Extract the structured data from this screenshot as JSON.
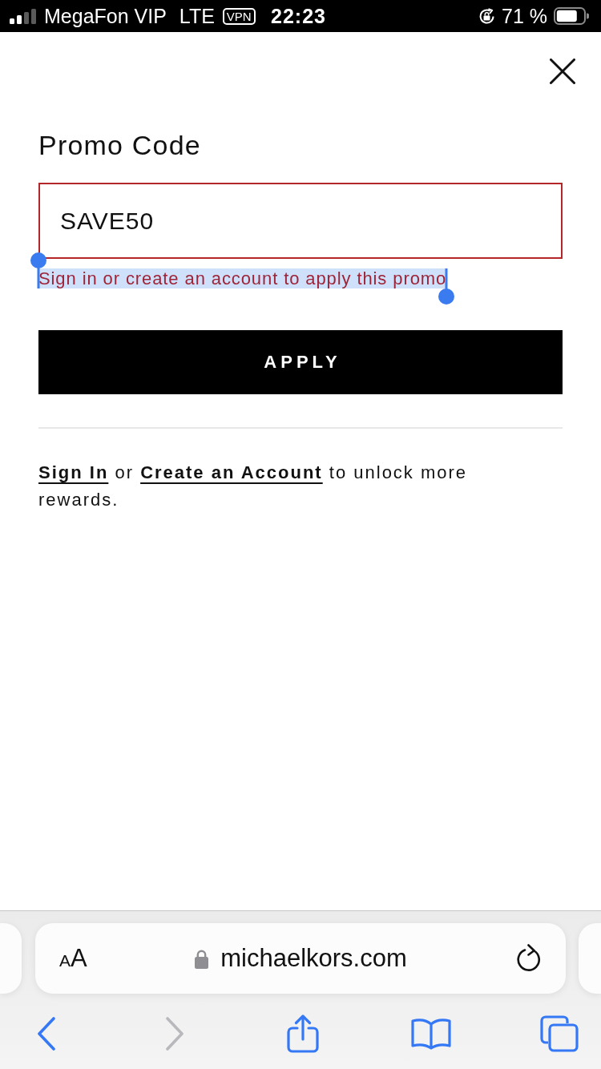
{
  "status_bar": {
    "carrier": "MegaFon VIP",
    "network": "LTE",
    "vpn": "VPN",
    "time": "22:23",
    "battery": "71 %"
  },
  "promo_dialog": {
    "title": "Promo Code",
    "promo_field": {
      "value": "SAVE50",
      "invalid": true
    },
    "error": {
      "text": "Sign in or create an account to apply this promo",
      "selected": true
    },
    "apply_button": "APPLY",
    "rewards_note": {
      "sign_in_link": "Sign In",
      "joiner": " or ",
      "create_account_link": "Create an Account",
      "tail": " to unlock more rewards."
    }
  },
  "browser": {
    "text_size_button": "AA",
    "url": "michaelkors.com",
    "toolbar": [
      {
        "kind": "back",
        "disabled": false
      },
      {
        "kind": "forward",
        "disabled": true
      },
      {
        "kind": "share",
        "disabled": false
      },
      {
        "kind": "bookmarks",
        "disabled": false
      },
      {
        "kind": "tabs",
        "disabled": false
      }
    ]
  }
}
